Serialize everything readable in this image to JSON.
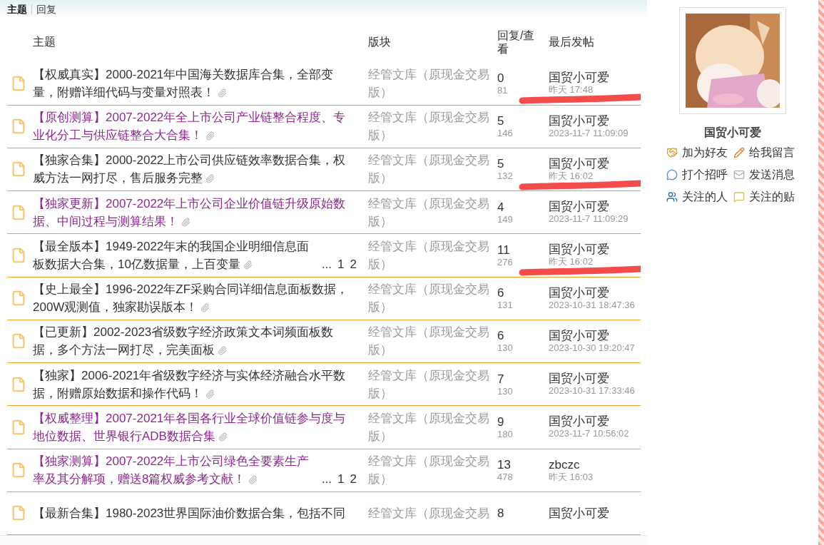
{
  "tabs": [
    {
      "label": "主题",
      "selected": true
    },
    {
      "label": "回复",
      "selected": false
    }
  ],
  "table": {
    "columns": [
      "主题",
      "版块",
      "回复/查看",
      "最后发帖"
    ],
    "rows": [
      {
        "title": "【权威真实】2000-2021年中国海关数据库合集，全部变量，附赠详细代码与变量对照表！",
        "color": "#333333",
        "attachment": true,
        "pages": [],
        "board": "经管文库（原现金交易版）",
        "replies": "0",
        "views": "81",
        "author": "国贸小可爱",
        "time": "昨天 17:48",
        "marked": true
      },
      {
        "title": "【原创测算】2007-2022年全上市公司产业链整合程度、专业化分工与供应链整合大合集！",
        "color": "#8e2a8e",
        "attachment": true,
        "pages": [],
        "board": "经管文库（原现金交易版）",
        "replies": "5",
        "views": "146",
        "author": "国贸小可爱",
        "time": "2023-11-7 11:09:09",
        "marked": false
      },
      {
        "title": "【独家合集】2000-2022上市公司供应链效率数据合集，权威方法一网打尽，售后服务完整",
        "color": "#333333",
        "attachment": true,
        "pages": [],
        "board": "经管文库（原现金交易版）",
        "replies": "5",
        "views": "132",
        "author": "国贸小可爱",
        "time": "昨天 16:02",
        "marked": true
      },
      {
        "title": "【独家更新】2007-2022年上市公司企业价值链升级原始数据、中间过程与测算结果！",
        "color": "#8e2a8e",
        "attachment": true,
        "pages": [],
        "board": "经管文库（原现金交易版）",
        "replies": "4",
        "views": "149",
        "author": "国贸小可爱",
        "time": "2023-11-7 11:09:29",
        "marked": false
      },
      {
        "title": "【最全版本】1949-2022年末的我国企业明细信息面板数据大合集，10亿数据量，上百变量",
        "color": "#333333",
        "attachment": true,
        "pages": [
          "...",
          "1",
          "2"
        ],
        "board": "经管文库（原现金交易版）",
        "replies": "11",
        "views": "276",
        "author": "国贸小可爱",
        "time": "昨天 16:02",
        "marked": true
      },
      {
        "title": "【史上最全】1996-2022年ZF采购合同详细信息面板数据，200W观测值，独家勘误版本！",
        "color": "#333333",
        "attachment": true,
        "pages": [],
        "board": "经管文库（原现金交易版）",
        "replies": "6",
        "views": "131",
        "author": "国贸小可爱",
        "time": "2023-10-31 18:47:36",
        "marked": false
      },
      {
        "title": "【已更新】2002-2023省级数字经济政策文本词频面板数据，多个方法一网打尽，完美面板",
        "color": "#333333",
        "attachment": true,
        "pages": [],
        "board": "经管文库（原现金交易版）",
        "replies": "6",
        "views": "130",
        "author": "国贸小可爱",
        "time": "2023-10-30 19:20:47",
        "marked": false
      },
      {
        "title": "【独家】2006-2021年省级数字经济与实体经济融合水平数据，附赠原始数据和操作代码！",
        "color": "#333333",
        "attachment": true,
        "pages": [],
        "board": "经管文库（原现金交易版）",
        "replies": "7",
        "views": "130",
        "author": "国贸小可爱",
        "time": "2023-10-31 17:33:46",
        "marked": false
      },
      {
        "title": "【权威整理】2007-2021年各国各行业全球价值链参与度与地位数据、世界银行ADB数据合集",
        "color": "#8e2a8e",
        "attachment": true,
        "pages": [],
        "board": "经管文库（原现金交易版）",
        "replies": "9",
        "views": "180",
        "author": "国贸小可爱",
        "time": "2023-11-7 10:56:02",
        "marked": false
      },
      {
        "title": "【独家测算】2007-2022年上市公司绿色全要素生产率及其分解项，赠送8篇权威参考文献！",
        "color": "#8e2a8e",
        "attachment": true,
        "pages": [
          "...",
          "1",
          "2"
        ],
        "board": "经管文库（原现金交易版）",
        "replies": "13",
        "views": "478",
        "author": "zbczc",
        "time": "昨天 16:03",
        "marked": false
      },
      {
        "title": "【最新合集】1980-2023世界国际油价数据合集，包括不同",
        "color": "#333333",
        "pages": [],
        "board": "经管文库（原现金交易",
        "replies": "8",
        "author": "国贸小可爱"
      }
    ]
  },
  "profile": {
    "name": "国贸小可爱",
    "actions": [
      {
        "label": "加为好友",
        "kind": "handshake"
      },
      {
        "label": "给我留言",
        "kind": "pencil"
      },
      {
        "label": "打个招呼",
        "kind": "greet"
      },
      {
        "label": "发送消息",
        "kind": "mail"
      },
      {
        "label": "关注的人",
        "kind": "users"
      },
      {
        "label": "关注的贴",
        "kind": "bubble"
      }
    ]
  }
}
